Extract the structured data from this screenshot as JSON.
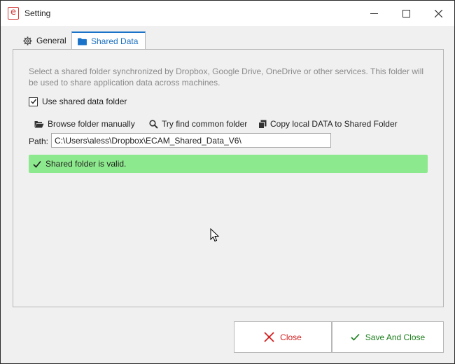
{
  "window": {
    "title": "Setting",
    "app_icon_glyph": "e"
  },
  "tabs": [
    {
      "label": "General",
      "icon": "gear-icon",
      "selected": false
    },
    {
      "label": "Shared Data",
      "icon": "folder-icon",
      "selected": true
    }
  ],
  "shared": {
    "description": "Select a shared folder synchronized by Dropbox, Google Drive, OneDrive or other services. This folder will be used to share application data across machines.",
    "use_shared_label": "Use shared data folder",
    "use_shared_checked": true,
    "browse_label": "Browse folder manually",
    "find_label": "Try find common folder",
    "copy_label": "Copy local DATA to Shared Folder",
    "path_label": "Path:",
    "path_value": "C:\\Users\\aless\\Dropbox\\ECAM_Shared_Data_V6\\",
    "status_text": "Shared folder is valid."
  },
  "footer": {
    "close_label": "Close",
    "save_label": "Save And Close"
  },
  "colors": {
    "accent": "#1a73c8",
    "valid_bg": "#8de98d",
    "close_red": "#d21f1f",
    "save_green": "#1a7d1a"
  }
}
